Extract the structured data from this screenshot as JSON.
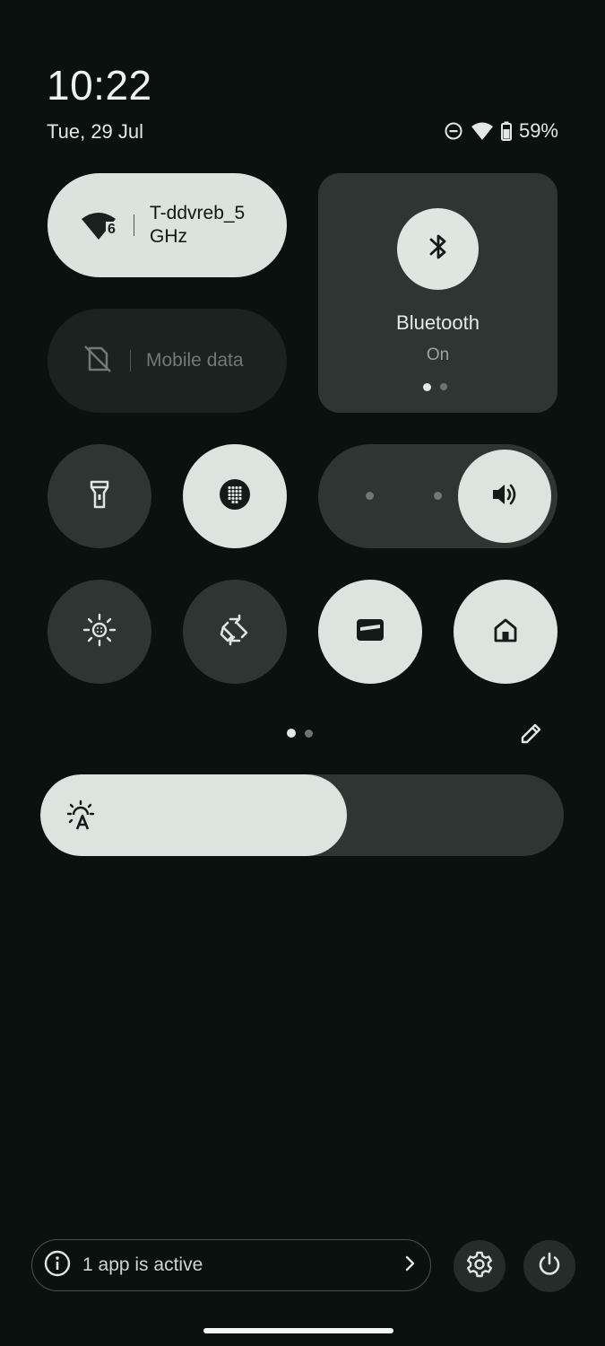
{
  "header": {
    "time": "10:22",
    "date": "Tue, 29 Jul",
    "battery_percent": "59%",
    "status_icons": [
      "dnd-icon",
      "wifi-icon",
      "battery-icon"
    ]
  },
  "tiles": {
    "wifi": {
      "label": "T-ddvreb_5 GHz",
      "badge": "6",
      "state": "on",
      "icon": "wifi-6-icon"
    },
    "mobile_data": {
      "label": "Mobile data",
      "state": "off",
      "icon": "no-sim-icon"
    },
    "bluetooth": {
      "label": "Bluetooth",
      "status": "On",
      "icon": "bluetooth-icon"
    },
    "flashlight": {
      "state": "off",
      "icon": "flashlight-icon"
    },
    "dialpad": {
      "state": "on",
      "icon": "dialpad-icon"
    },
    "volume": {
      "level": 1.0,
      "icon": "volume-icon"
    },
    "extra_dim": {
      "state": "off",
      "icon": "brightness-dim-icon"
    },
    "auto_rotate": {
      "state": "off",
      "icon": "rotate-icon"
    },
    "wallet": {
      "state": "on",
      "icon": "wallet-icon"
    },
    "home": {
      "state": "on",
      "icon": "home-icon"
    }
  },
  "pager": {
    "pages": 2,
    "current": 1
  },
  "brightness": {
    "level": 0.585,
    "icon": "auto-brightness-icon"
  },
  "footer": {
    "active_apps_label": "1 app is active",
    "icons": [
      "info-icon",
      "chevron-right-icon",
      "settings-icon",
      "power-icon"
    ]
  },
  "colors": {
    "background": "#0b110f",
    "tile_on": "#dce4df",
    "tile_off": "#2e3532",
    "text_primary": "#e3e8e4"
  }
}
